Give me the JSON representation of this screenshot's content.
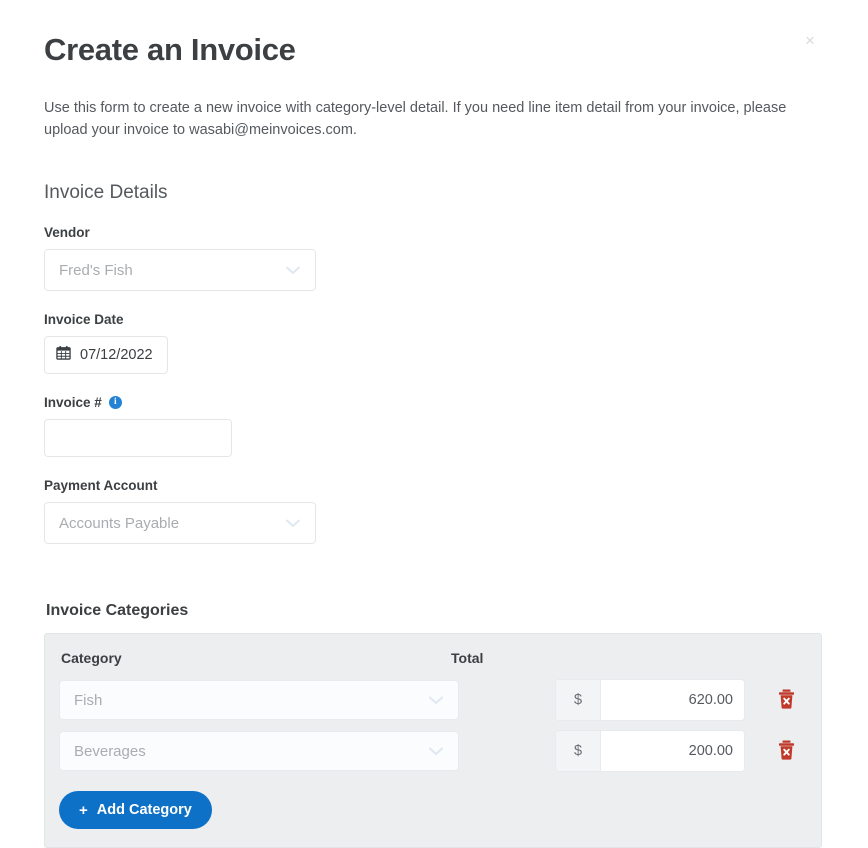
{
  "modal": {
    "title": "Create an Invoice",
    "close_label": "×",
    "intro": "Use this form to create a new invoice with category-level detail. If you need line item detail from your invoice, please upload your invoice to wasabi@meinvoices.com."
  },
  "details": {
    "heading": "Invoice Details",
    "vendor": {
      "label": "Vendor",
      "value": "Fred's Fish"
    },
    "invoice_date": {
      "label": "Invoice Date",
      "value": "07/12/2022"
    },
    "invoice_number": {
      "label": "Invoice #",
      "info_glyph": "i",
      "value": "",
      "placeholder": ""
    },
    "payment_account": {
      "label": "Payment Account",
      "value": "Accounts Payable"
    }
  },
  "categories": {
    "heading": "Invoice Categories",
    "columns": {
      "category": "Category",
      "total": "Total"
    },
    "currency_symbol": "$",
    "rows": [
      {
        "category": "Fish",
        "amount": "620.00"
      },
      {
        "category": "Beverages",
        "amount": "200.00"
      }
    ],
    "add_button": {
      "plus": "+",
      "label": "Add Category"
    }
  },
  "colors": {
    "accent_blue": "#0d71c8",
    "info_blue": "#2483d4",
    "danger_red": "#c0392b",
    "panel_grey": "#eceef0"
  }
}
